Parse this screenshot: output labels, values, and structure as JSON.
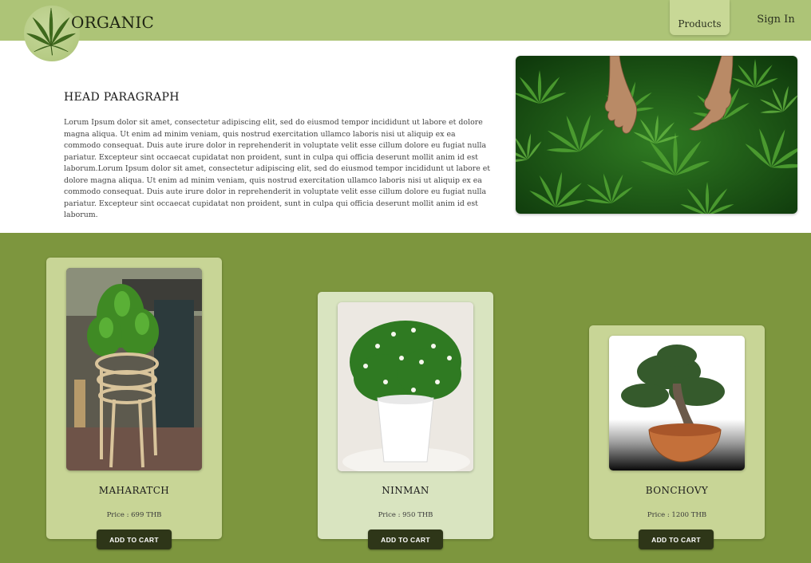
{
  "header": {
    "brand": "ORGANIC",
    "nav": {
      "products": "Products",
      "sign_in": "Sign In"
    }
  },
  "hero": {
    "title": "HEAD PARAGRAPH",
    "body": "Lorum Ipsum dolor sit amet, consectetur adipiscing elit, sed do eiusmod tempor incididunt ut labore et dolore magna aliqua. Ut enim ad minim veniam, quis nostrud exercitation ullamco laboris nisi ut aliquip ex ea commodo consequat. Duis aute irure dolor in reprehenderit in voluptate velit esse cillum dolore eu fugiat nulla pariatur. Excepteur sint occaecat cupidatat non proident, sunt in culpa qui officia deserunt mollit anim id est laborum.Lorum Ipsum dolor sit amet, consectetur adipiscing elit, sed do eiusmod tempor incididunt ut labore et dolore magna aliqua. Ut enim ad minim veniam, quis nostrud exercitation ullamco laboris nisi ut aliquip ex ea commodo consequat. Duis aute irure dolor in reprehenderit in voluptate velit esse cillum dolore eu fugiat nulla pariatur. Excepteur sint occaecat cupidatat non proident, sunt in culpa qui officia deserunt mollit anim id est laborum."
  },
  "products": [
    {
      "name": "MAHARATCH",
      "price": "Price : 699 THB",
      "button": "ADD TO CART"
    },
    {
      "name": "NINMAN",
      "price": "Price : 950 THB",
      "button": "ADD TO CART"
    },
    {
      "name": "BONCHOVY",
      "price": "Price : 1200 THB",
      "button": "ADD TO CART"
    }
  ],
  "colors": {
    "header_bg": "#adc477",
    "section_bg": "#7d963e",
    "card_1": "#c8d596",
    "card_2": "#d9e4c0",
    "card_3": "#c8d596",
    "button": "#2e3618"
  },
  "icons": {
    "logo": "cannabis-leaf-icon"
  }
}
